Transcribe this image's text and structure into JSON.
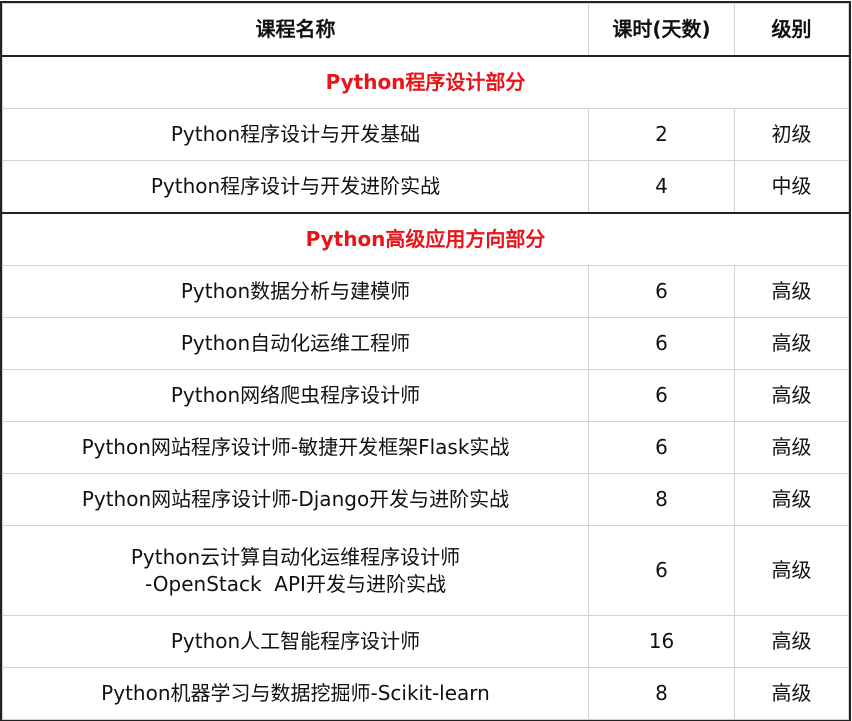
{
  "table": {
    "headers": {
      "name": "课程名称",
      "days": "课时(天数)",
      "level": "级别"
    },
    "sections": [
      {
        "title": "Python程序设计部分",
        "rows": [
          {
            "name_lines": [
              "Python程序设计与开发基础"
            ],
            "days": "2",
            "level": "初级"
          },
          {
            "name_lines": [
              "Python程序设计与开发进阶实战"
            ],
            "days": "4",
            "level": "中级"
          }
        ]
      },
      {
        "title": "Python高级应用方向部分",
        "rows": [
          {
            "name_lines": [
              "Python数据分析与建模师"
            ],
            "days": "6",
            "level": "高级"
          },
          {
            "name_lines": [
              "Python自动化运维工程师"
            ],
            "days": "6",
            "level": "高级"
          },
          {
            "name_lines": [
              "Python网络爬虫程序设计师"
            ],
            "days": "6",
            "level": "高级"
          },
          {
            "name_lines": [
              "Python网站程序设计师-敏捷开发框架Flask实战"
            ],
            "days": "6",
            "level": "高级"
          },
          {
            "name_lines": [
              "Python网站程序设计师-Django开发与进阶实战"
            ],
            "days": "8",
            "level": "高级"
          },
          {
            "name_lines": [
              "Python云计算自动化运维程序设计师",
              "-OpenStack  API开发与进阶实战"
            ],
            "days": "6",
            "level": "高级"
          },
          {
            "name_lines": [
              "Python人工智能程序设计师"
            ],
            "days": "16",
            "level": "高级"
          },
          {
            "name_lines": [
              "Python机器学习与数据挖掘师-Scikit-learn"
            ],
            "days": "8",
            "level": "高级"
          }
        ]
      }
    ]
  },
  "colors": {
    "section_title": "#e8141a",
    "border_outer": "#222222",
    "border_inner": "#d2d2d2"
  }
}
